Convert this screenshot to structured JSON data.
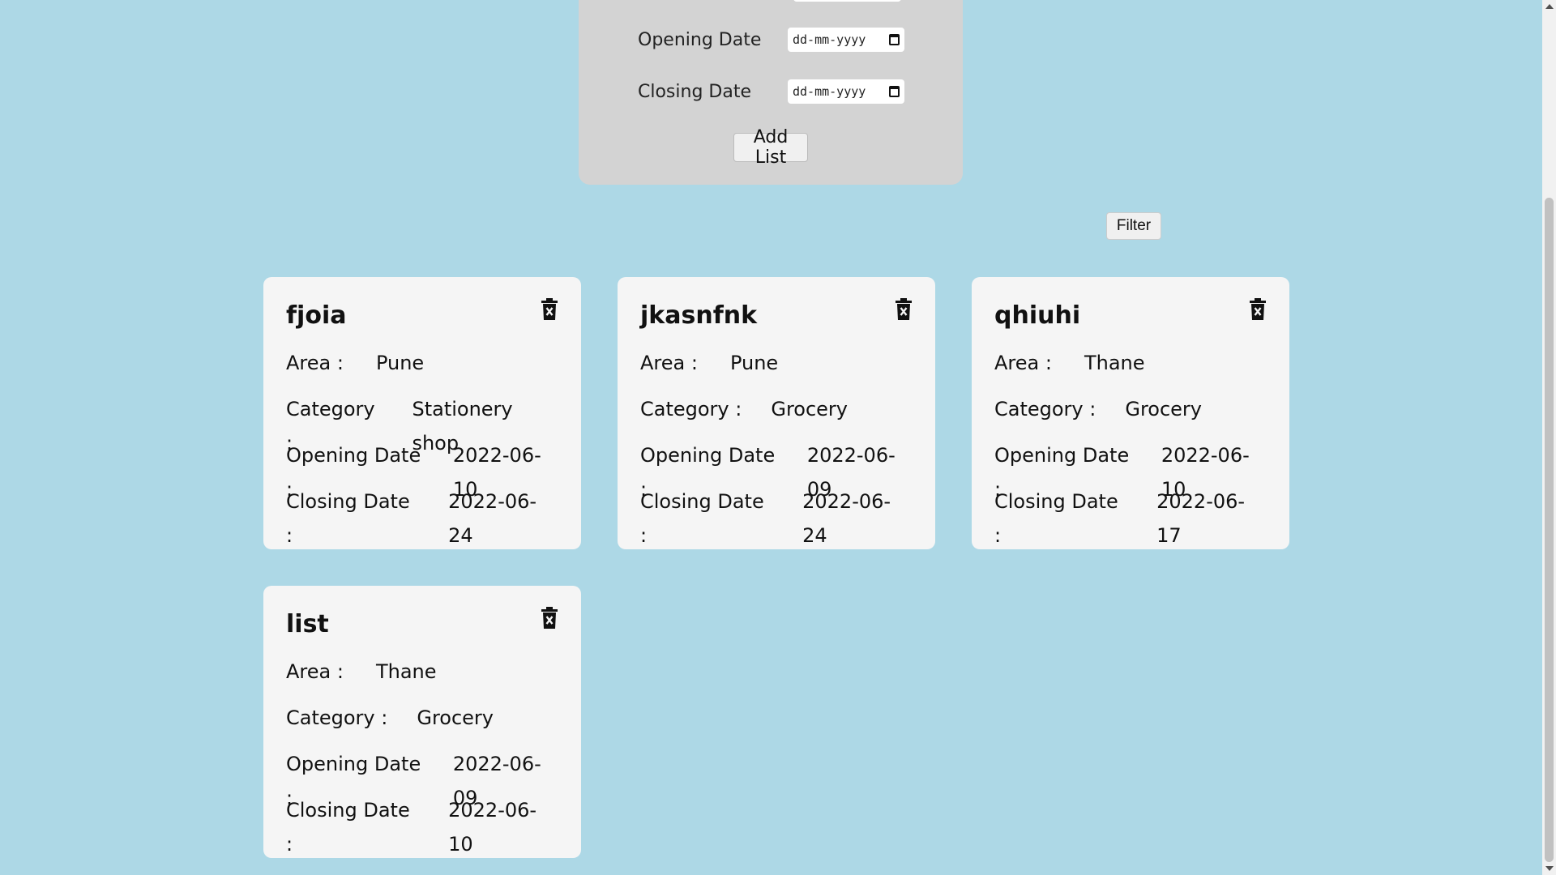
{
  "form": {
    "opening_label": "Opening Date",
    "closing_label": "Closing Date",
    "opening_placeholder": "dd-mm-yyyy",
    "closing_placeholder": "dd-mm-yyyy",
    "add_button": "Add List"
  },
  "filter_button": "Filter",
  "labels": {
    "area": "Area :",
    "category": "Category :",
    "opening": "Opening Date :",
    "closing": "Closing Date :"
  },
  "cards": [
    {
      "title": "fjoia",
      "area": "Pune",
      "category": "Stationery shop",
      "opening": "2022-06-10",
      "closing": "2022-06-24"
    },
    {
      "title": "jkasnfnk",
      "area": "Pune",
      "category": "Grocery",
      "opening": "2022-06-09",
      "closing": "2022-06-24"
    },
    {
      "title": "qhiuhi",
      "area": "Thane",
      "category": "Grocery",
      "opening": "2022-06-10",
      "closing": "2022-06-17"
    },
    {
      "title": "list",
      "area": "Thane",
      "category": "Grocery",
      "opening": "2022-06-09",
      "closing": "2022-06-10"
    }
  ],
  "icons": {
    "delete": "trash-x-icon",
    "calendar": "calendar-icon"
  },
  "colors": {
    "background": "#add8e6",
    "panel": "#d3d3d3",
    "card": "#f5f5f5"
  }
}
